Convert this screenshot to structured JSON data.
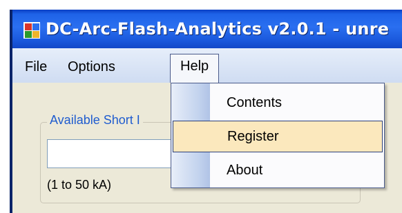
{
  "window": {
    "title": "DC-Arc-Flash-Analytics v2.0.1 - unre"
  },
  "menubar": {
    "items": [
      {
        "label": "File"
      },
      {
        "label": "Options"
      },
      {
        "label": "Help"
      }
    ]
  },
  "help_menu": {
    "items": [
      {
        "label": "Contents"
      },
      {
        "label": "Register",
        "highlighted": true
      },
      {
        "label": "About"
      }
    ]
  },
  "short_circuit_group": {
    "label": "Available Short I",
    "input_value": "",
    "range_hint": "(1 to 50 kA)"
  },
  "colors": {
    "titlebar": "#2a6ff0",
    "menubar": "#d6e2f5",
    "highlight": "#fbe8bd",
    "group_label": "#1f5ccf"
  }
}
